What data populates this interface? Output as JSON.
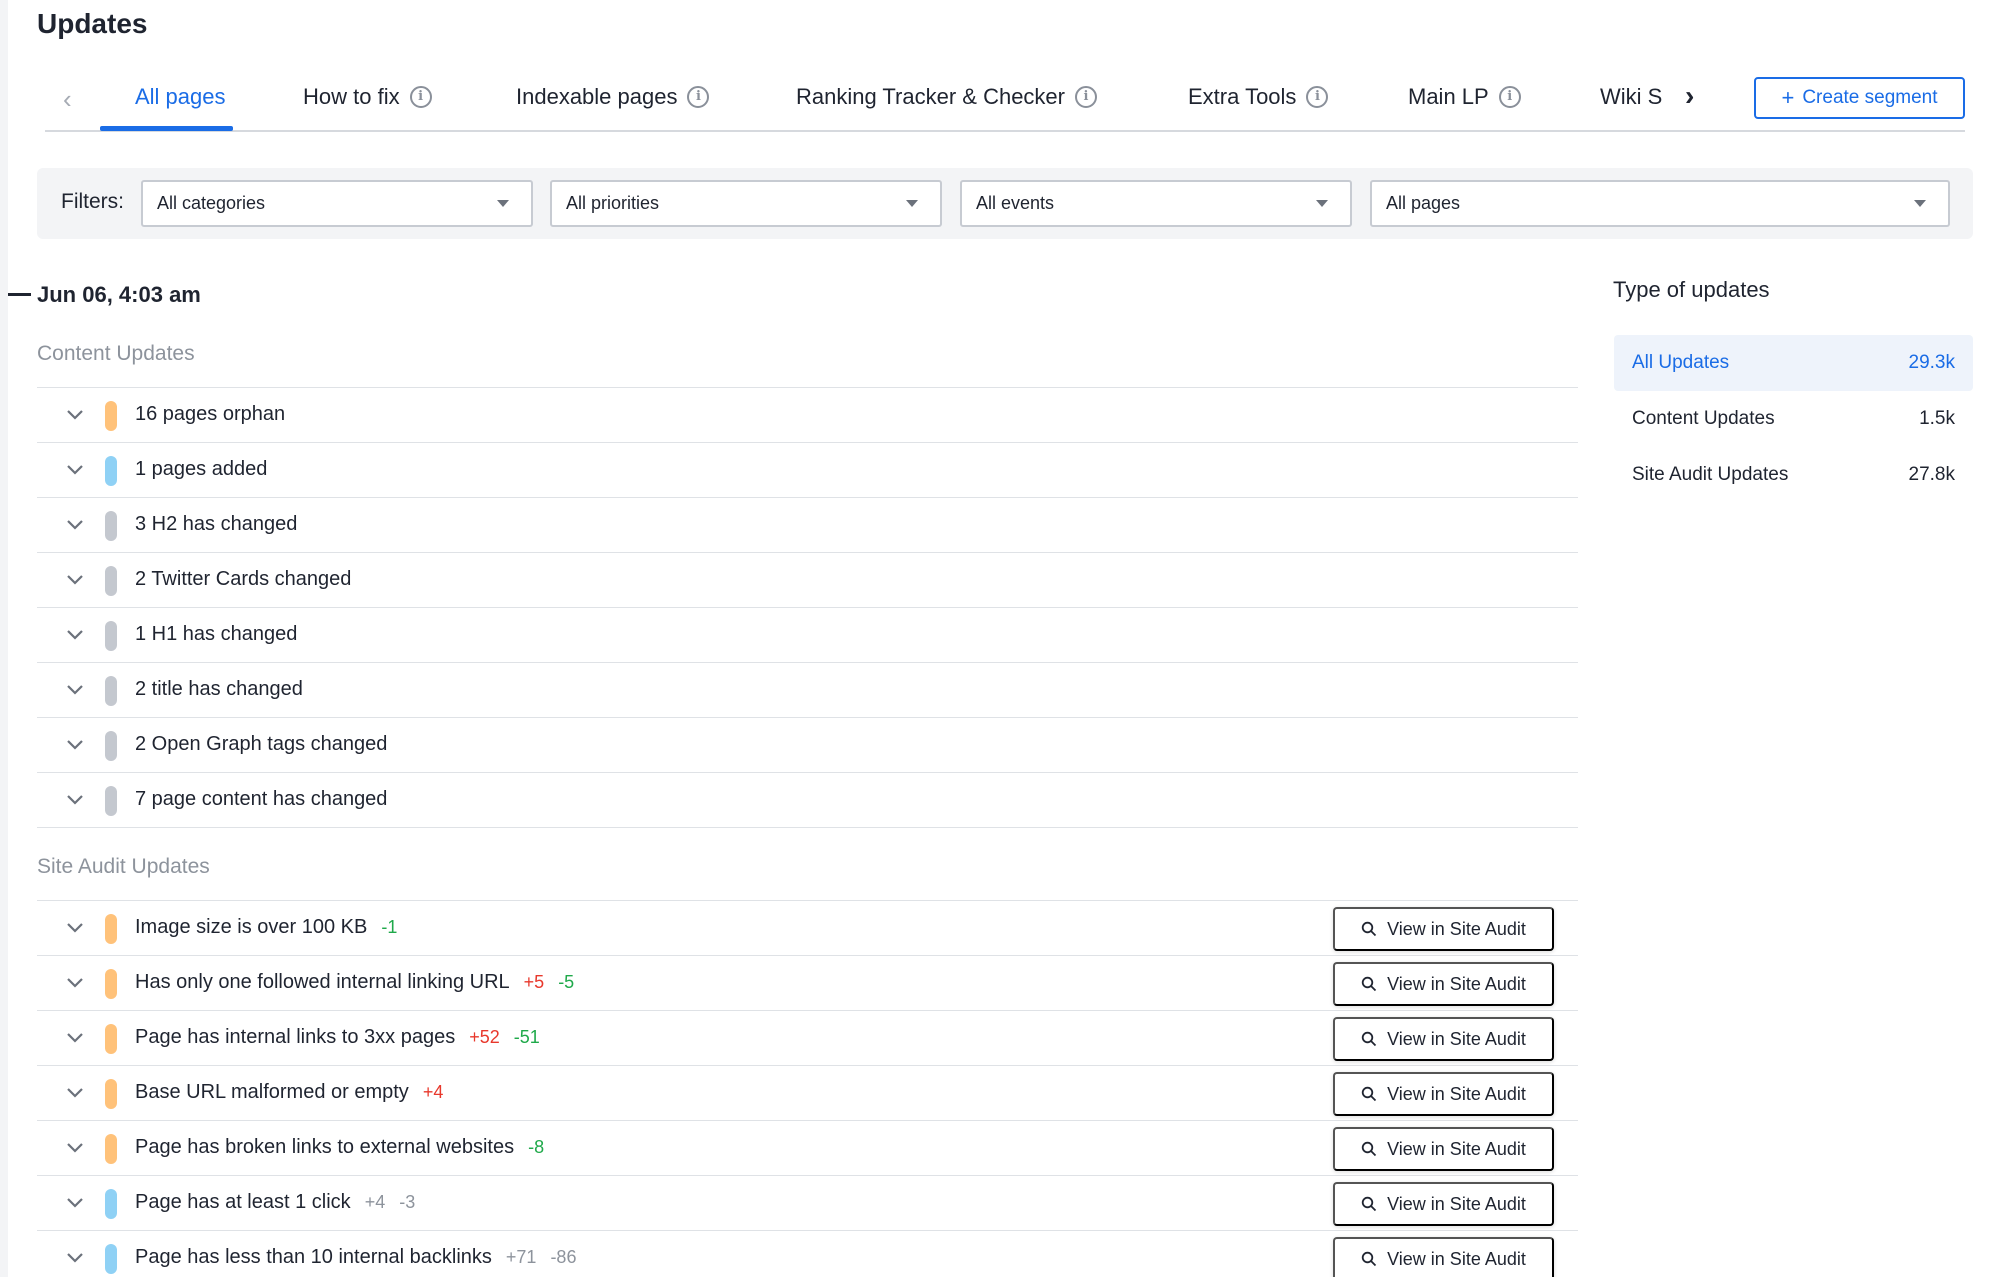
{
  "page": {
    "title": "Updates"
  },
  "tabs": [
    {
      "label": "All pages",
      "active": true,
      "info": false
    },
    {
      "label": "How to fix",
      "info": true
    },
    {
      "label": "Indexable pages",
      "info": true
    },
    {
      "label": "Ranking Tracker & Checker",
      "info": true
    },
    {
      "label": "Extra Tools",
      "info": true
    },
    {
      "label": "Main LP",
      "info": true
    },
    {
      "label": "Wiki S",
      "info": false
    }
  ],
  "create_segment": {
    "label": "Create segment",
    "icon": "plus-icon"
  },
  "filters": {
    "label": "Filters:",
    "categories": "All categories",
    "priorities": "All priorities",
    "events": "All events",
    "pages": "All pages"
  },
  "date": "Jun 06, 4:03 am",
  "content_updates": {
    "title": "Content Updates",
    "rows": [
      {
        "label": "16 pages orphan",
        "color": "#ffc27a"
      },
      {
        "label": "1 pages added",
        "color": "#8fd1f5"
      },
      {
        "label": "3 H2 has changed",
        "color": "#c4c8cf"
      },
      {
        "label": "2 Twitter Cards changed",
        "color": "#c4c8cf"
      },
      {
        "label": "1 H1 has changed",
        "color": "#c4c8cf"
      },
      {
        "label": "2 title has changed",
        "color": "#c4c8cf"
      },
      {
        "label": "2 Open Graph tags changed",
        "color": "#c4c8cf"
      },
      {
        "label": "7 page content has changed",
        "color": "#c4c8cf"
      }
    ]
  },
  "site_audit_updates": {
    "title": "Site Audit Updates",
    "button_label": "View in Site Audit",
    "rows": [
      {
        "label": "Image size is over 100 KB",
        "color": "#ffc27a",
        "plus": "",
        "minus": "-1",
        "muted": false
      },
      {
        "label": "Has only one followed internal linking URL",
        "color": "#ffc27a",
        "plus": "+5",
        "minus": "-5",
        "muted": false
      },
      {
        "label": "Page has internal links to 3xx pages",
        "color": "#ffc27a",
        "plus": "+52",
        "minus": "-51",
        "muted": false
      },
      {
        "label": "Base URL malformed or empty",
        "color": "#ffc27a",
        "plus": "+4",
        "minus": "",
        "muted": false
      },
      {
        "label": "Page has broken links to external websites",
        "color": "#ffc27a",
        "plus": "",
        "minus": "-8",
        "muted": false
      },
      {
        "label": "Page has at least 1 click",
        "color": "#8fd1f5",
        "plus": "+4",
        "minus": "-3",
        "muted": true
      },
      {
        "label": "Page has less than 10 internal backlinks",
        "color": "#8fd1f5",
        "plus": "+71",
        "minus": "-86",
        "muted": true
      }
    ]
  },
  "type_of_updates": {
    "title": "Type of updates",
    "items": [
      {
        "label": "All Updates",
        "count": "29.3k",
        "active": true
      },
      {
        "label": "Content Updates",
        "count": "1.5k",
        "active": false
      },
      {
        "label": "Site Audit Updates",
        "count": "27.8k",
        "active": false
      }
    ]
  },
  "colors": {
    "accent": "#1a6ce6",
    "positive": "#1fa94a",
    "negative": "#e8382c",
    "muted": "#8d939c"
  }
}
